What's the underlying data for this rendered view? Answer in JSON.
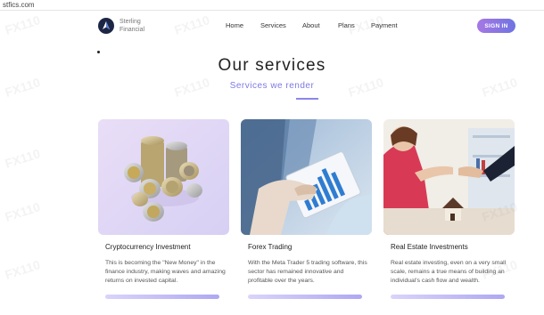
{
  "browser": {
    "url": "stfics.com"
  },
  "header": {
    "brand_line1": "Sterling",
    "brand_line2": "Financial",
    "nav": [
      "Home",
      "Services",
      "About",
      "Plans",
      "Payment"
    ],
    "signin": "SIGN IN"
  },
  "services": {
    "title": "Our services",
    "subtitle": "Services we render",
    "cards": [
      {
        "title": "Cryptocurrency Investment",
        "text": "This is becoming the \"New Money\" in the finance industry, making waves and amazing returns on invested capital."
      },
      {
        "title": "Forex Trading",
        "text": "With the Meta Trader 5 trading software, this sector has remained innovative and profitable over the years."
      },
      {
        "title": "Real Estate Investments",
        "text": "Real estate investing, even on a very small scale, remains a true means of building an individual's cash flow and wealth."
      }
    ]
  },
  "watermark": "FX110"
}
